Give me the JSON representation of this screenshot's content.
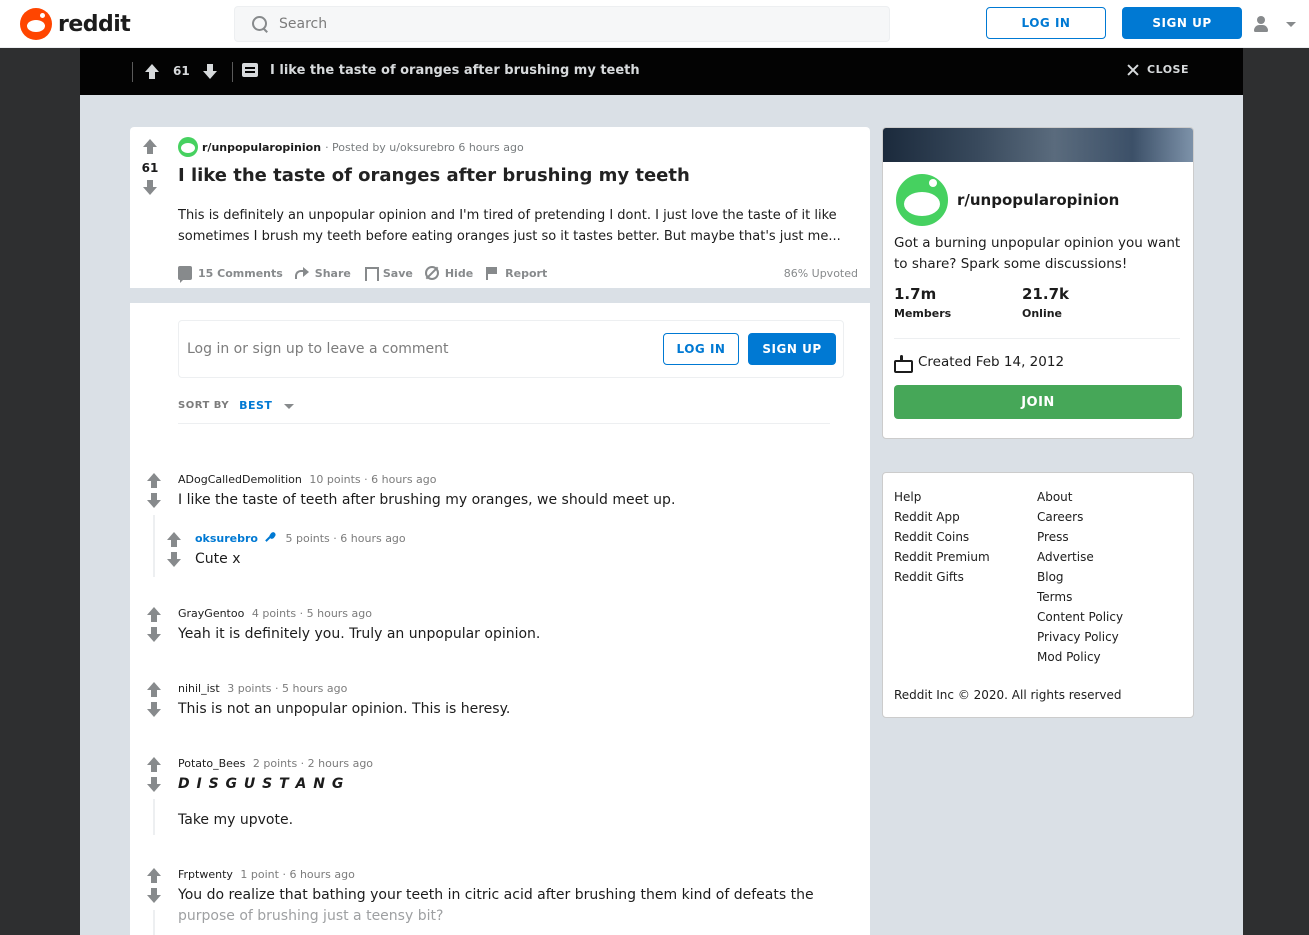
{
  "header": {
    "logo_text": "reddit",
    "search_placeholder": "Search",
    "login_label": "LOG IN",
    "signup_label": "SIGN UP"
  },
  "overlay": {
    "score": "61",
    "title": "I like the taste of oranges after brushing my teeth",
    "close_label": "CLOSE"
  },
  "post": {
    "score": "61",
    "subreddit": "r/unpopularopinion",
    "posted_by": "· Posted by u/oksurebro 6 hours ago",
    "title": "I like the taste of oranges after brushing my teeth",
    "body": "This is definitely an unpopular opinion and I'm tired of pretending I dont. I just love the taste of it like sometimes I brush my teeth before eating oranges just so it tastes better. But maybe that's just me...",
    "actions": {
      "comments": "15 Comments",
      "share": "Share",
      "save": "Save",
      "hide": "Hide",
      "report": "Report"
    },
    "upvoted": "86% Upvoted"
  },
  "comment_box": {
    "prompt": "Log in or sign up to leave a comment",
    "login_label": "LOG IN",
    "signup_label": "SIGN UP"
  },
  "sort": {
    "label": "SORT BY",
    "value": "BEST"
  },
  "comments": [
    {
      "author": "ADogCalledDemolition",
      "points": "10 points",
      "time": "· 6 hours ago",
      "body": "I like the taste of teeth after brushing my oranges, we should meet up."
    },
    {
      "author": "oksurebro",
      "points": "5 points",
      "time": "· 6 hours ago",
      "body": "Cute x"
    },
    {
      "author": "GrayGentoo",
      "points": "4 points",
      "time": "· 5 hours ago",
      "body": "Yeah it is definitely you. Truly an unpopular opinion."
    },
    {
      "author": "nihil_ist",
      "points": "3 points",
      "time": "· 5 hours ago",
      "body": "This is not an unpopular opinion. This is heresy."
    },
    {
      "author": "Potato_Bees",
      "points": "2 points",
      "time": "· 2 hours ago",
      "body": "D I S G U S T A N G",
      "body2": "Take my upvote."
    },
    {
      "author": "Frptwenty",
      "points": "1 point",
      "time": "· 6 hours ago",
      "body": "You do realize that bathing your teeth in citric acid after brushing them kind of defeats the",
      "body2": "purpose of brushing just a teensy bit?"
    }
  ],
  "sidebar": {
    "subreddit": "r/unpopularopinion",
    "description": "Got a burning unpopular opinion you want to share? Spark some discussions!",
    "members_value": "1.7m",
    "members_label": "Members",
    "online_value": "21.7k",
    "online_label": "Online",
    "created": "Created Feb 14, 2012",
    "join_label": "JOIN"
  },
  "footer": {
    "col1": [
      "Help",
      "Reddit App",
      "Reddit Coins",
      "Reddit Premium",
      "Reddit Gifts"
    ],
    "col2": [
      "About",
      "Careers",
      "Press",
      "Advertise",
      "Blog",
      "Terms",
      "Content Policy",
      "Privacy Policy",
      "Mod Policy"
    ],
    "copyright": "Reddit Inc © 2020. All rights reserved"
  },
  "colors": {
    "brand": "#ff4500",
    "accent": "#0079d3",
    "join": "#46a758",
    "sub_avatar": "#46d160"
  }
}
